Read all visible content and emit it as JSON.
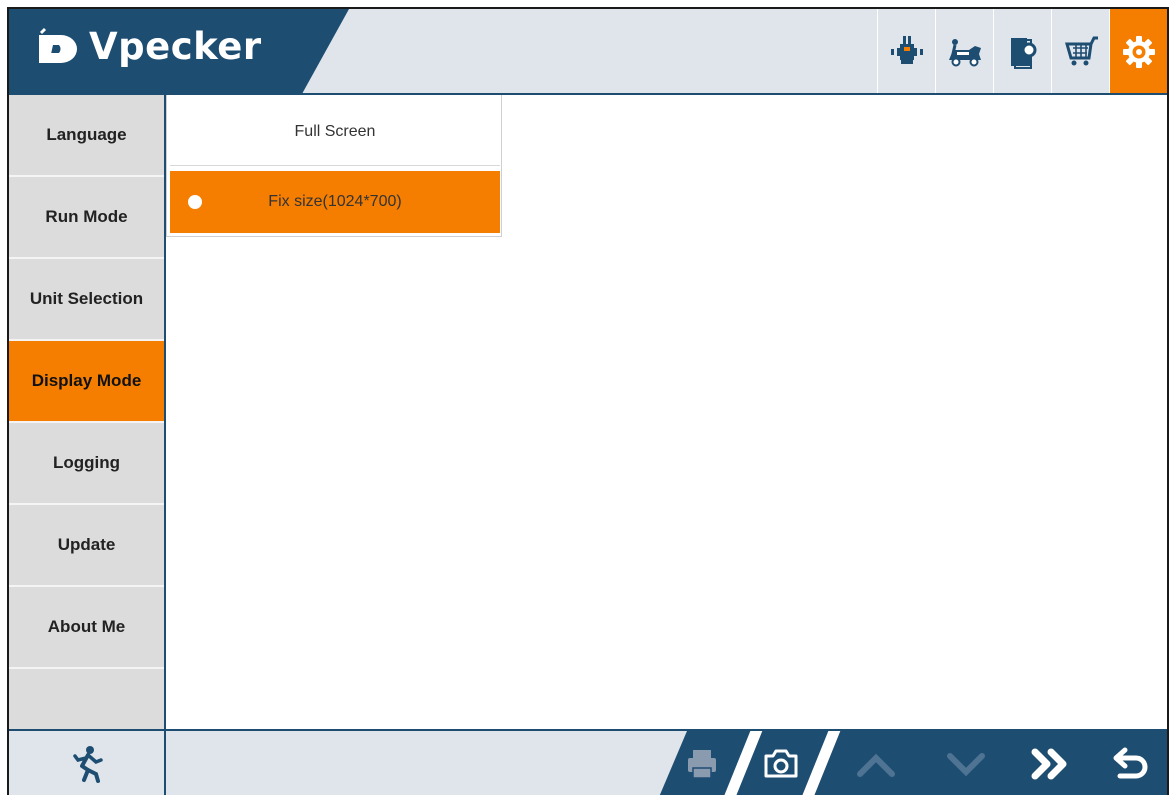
{
  "app": {
    "brand_name": "Vpecker",
    "brand_logo_text": "D"
  },
  "toolbar": {
    "buttons": [
      {
        "name": "diagnose",
        "icon": "engine-diagnostic-icon"
      },
      {
        "name": "vehicle",
        "icon": "car-repair-icon"
      },
      {
        "name": "manual",
        "icon": "book-search-icon"
      },
      {
        "name": "shop",
        "icon": "shopping-cart-icon"
      },
      {
        "name": "settings",
        "icon": "gear-icon",
        "active": true
      }
    ]
  },
  "sidebar": {
    "items": [
      {
        "label": "Language"
      },
      {
        "label": "Run Mode"
      },
      {
        "label": "Unit Selection"
      },
      {
        "label": "Display Mode",
        "active": true
      },
      {
        "label": "Logging"
      },
      {
        "label": "Update"
      },
      {
        "label": "About Me"
      }
    ]
  },
  "display_mode": {
    "options": [
      {
        "label": "Full Screen",
        "selected": false
      },
      {
        "label": "Fix size(1024*700)",
        "selected": true
      }
    ]
  },
  "bottombar": {
    "icons": [
      "running-man-icon",
      "printer-icon",
      "camera-icon",
      "chevron-up-icon",
      "chevron-down-icon",
      "double-chevron-right-icon",
      "return-icon"
    ]
  },
  "colors": {
    "brand_navy": "#1e4d72",
    "accent_orange": "#f57e00",
    "panel_gray": "#dcdcdc",
    "toolbar_bg": "#dfe5eb"
  }
}
